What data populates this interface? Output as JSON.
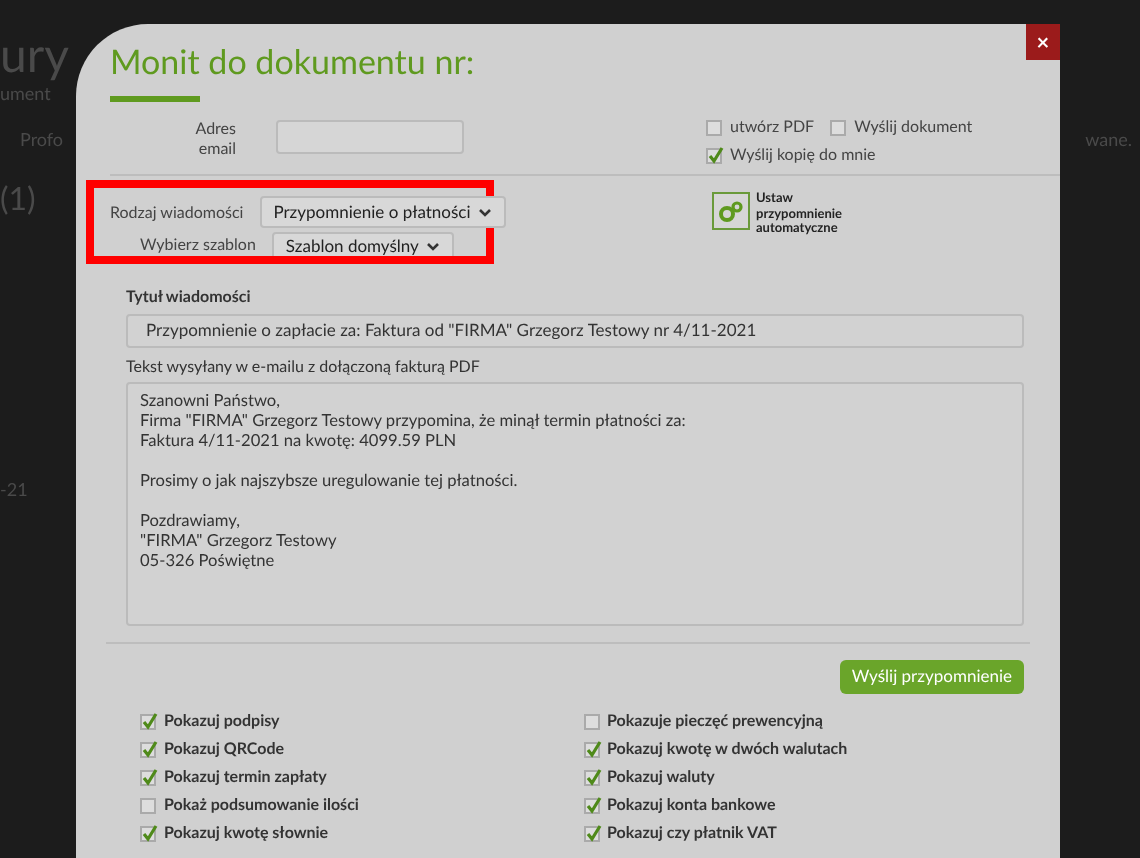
{
  "background": {
    "texts": [
      "ury",
      "ument",
      "Profo",
      "(1)",
      "wane.",
      "-21"
    ]
  },
  "dialog": {
    "title": "Monit do dokumentu nr:",
    "close": "×",
    "email": {
      "label": "Adres email"
    },
    "options": [
      {
        "label": "utwórz PDF",
        "checked": false
      },
      {
        "label": "Wyślij dokument",
        "checked": false
      },
      {
        "label": "Wyślij kopię do mnie",
        "checked": true
      }
    ],
    "message_type": {
      "label": "Rodzaj wiadomości",
      "value": "Przypomnienie o płatności"
    },
    "template": {
      "label": "Wybierz szablon",
      "value": "Szablon domyślny"
    },
    "auto_reminder": {
      "label": "Ustaw przypomnienie automatyczne"
    },
    "subject": {
      "label": "Tytuł wiadomości",
      "value": "Przypomnienie o zapłacie za: Faktura od \"FIRMA\" Grzegorz Testowy nr 4/11-2021"
    },
    "body": {
      "label": "Tekst wysyłany w e-mailu z dołączoną fakturą PDF",
      "value": "Szanowni Państwo,\nFirma \"FIRMA\" Grzegorz Testowy przypomina, że minął termin płatności za:\nFaktura 4/11-2021 na kwotę: 4099.59 PLN\n\nProsimy o jak najszybsze uregulowanie tej płatności.\n\nPozdrawiamy,\n\"FIRMA\" Grzegorz Testowy\n05-326 Poświętne"
    },
    "send_button": "Wyślij przypomnienie",
    "settings": [
      {
        "label": "Pokazuj podpisy",
        "checked": true
      },
      {
        "label": "Pokazuje pieczęć prewencyjną",
        "checked": false
      },
      {
        "label": "Pokazuj QRCode",
        "checked": true
      },
      {
        "label": "Pokazuj kwotę w dwóch walutach",
        "checked": true
      },
      {
        "label": "Pokazuj termin zapłaty",
        "checked": true
      },
      {
        "label": "Pokazuj waluty",
        "checked": true
      },
      {
        "label": "Pokaż podsumowanie ilości",
        "checked": false
      },
      {
        "label": "Pokazuj konta bankowe",
        "checked": true
      },
      {
        "label": "Pokazuj kwotę słownie",
        "checked": true
      },
      {
        "label": "Pokazuj czy płatnik VAT",
        "checked": true
      }
    ]
  }
}
